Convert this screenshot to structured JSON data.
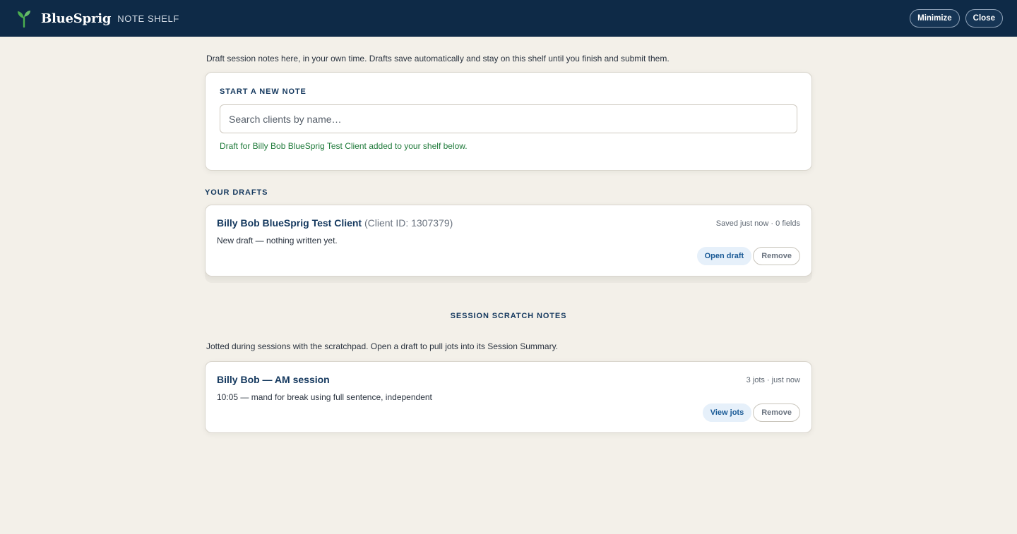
{
  "header": {
    "brand_name": "BlueSprig",
    "brand_sub": "NOTE SHELF",
    "minimize_label": "Minimize",
    "close_label": "Close"
  },
  "intro": "Draft session notes here, in your own time. Drafts save automatically and stay on this shelf until you finish and submit them.",
  "new_note": {
    "heading": "START A NEW NOTE",
    "search_placeholder": "Search clients by name…",
    "success_message": "Draft for Billy Bob BlueSprig Test Client added to your shelf below."
  },
  "drafts": {
    "heading": "YOUR DRAFTS",
    "items": [
      {
        "client_name": "Billy Bob BlueSprig Test Client",
        "client_id": "(Client ID: 1307379)",
        "meta": "Saved just now · 0 fields",
        "preview": "New draft — nothing written yet.",
        "open_label": "Open draft",
        "remove_label": "Remove"
      }
    ]
  },
  "scratch": {
    "heading": "SESSION SCRATCH NOTES",
    "intro": "Jotted during sessions with the scratchpad. Open a draft to pull jots into its Session Summary.",
    "items": [
      {
        "title": "Billy Bob — AM session",
        "meta": "3 jots · just now",
        "preview": "10:05 — mand for break using full sentence, independent",
        "view_label": "View jots",
        "remove_label": "Remove"
      }
    ]
  },
  "colors": {
    "header_bg": "#0e2a47",
    "page_bg": "#f3f0e9",
    "accent_green": "#4caf50",
    "success_text": "#1f7a3a",
    "title_blue": "#14385e"
  },
  "icons": {
    "brand_logo": "sprout-icon"
  }
}
